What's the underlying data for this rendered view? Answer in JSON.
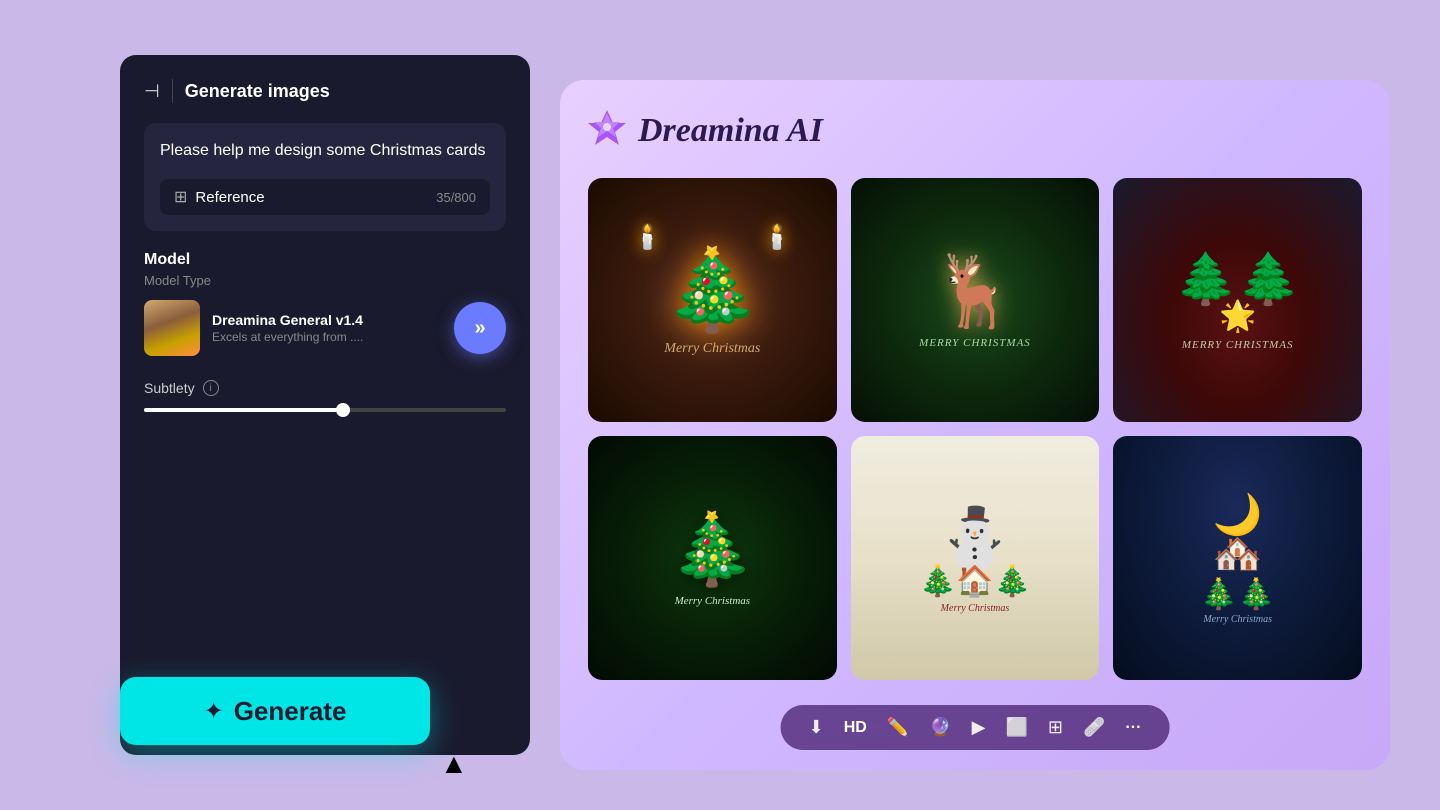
{
  "app": {
    "title": "Dreamina AI"
  },
  "left_panel": {
    "header": {
      "icon": "⊣",
      "title": "Generate images"
    },
    "prompt": {
      "text": "Please help me design some Christmas cards",
      "char_count": "35/800"
    },
    "reference_button": {
      "label": "Reference",
      "icon": "⊞"
    },
    "model_section": {
      "title": "Model",
      "subtitle": "Model Type",
      "name": "Dreamina General v1.4",
      "description": "Excels at everything from ...."
    },
    "subtlety": {
      "label": "Subtlety",
      "info": "i",
      "value": 55
    },
    "generate_button": {
      "label": "Generate",
      "icon": "✦"
    }
  },
  "right_panel": {
    "logo": "✦",
    "title": "Dreamina AI",
    "images": [
      {
        "id": 1,
        "alt": "Christmas tree card with candles"
      },
      {
        "id": 2,
        "alt": "Reindeer Christmas card"
      },
      {
        "id": 3,
        "alt": "Winter forest Christmas card"
      },
      {
        "id": 4,
        "alt": "3D paper cut Christmas tree card"
      },
      {
        "id": 5,
        "alt": "Snow globe Christmas card"
      },
      {
        "id": 6,
        "alt": "Pop-up village Christmas card"
      }
    ],
    "toolbar": {
      "tools": [
        {
          "name": "download",
          "icon": "⬇",
          "label": ""
        },
        {
          "name": "hd",
          "icon": "",
          "label": "HD"
        },
        {
          "name": "magic-pen",
          "icon": "✏",
          "label": ""
        },
        {
          "name": "erase",
          "icon": "✂",
          "label": ""
        },
        {
          "name": "play",
          "icon": "▶",
          "label": ""
        },
        {
          "name": "expand",
          "icon": "⬜",
          "label": ""
        },
        {
          "name": "resize",
          "icon": "⊞",
          "label": ""
        },
        {
          "name": "band-aid",
          "icon": "🩹",
          "label": ""
        },
        {
          "name": "more",
          "icon": "···",
          "label": ""
        }
      ]
    }
  }
}
